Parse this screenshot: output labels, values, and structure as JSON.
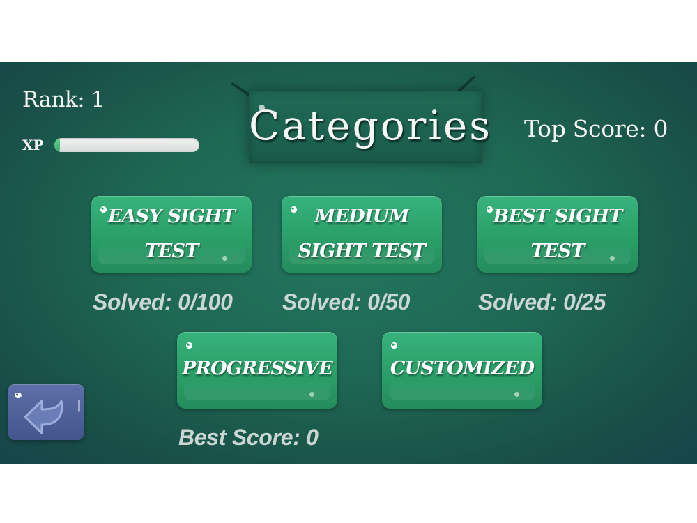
{
  "header": {
    "rank_label": "Rank: 1",
    "xp_label": "XP",
    "xp_progress": 0.04,
    "top_score_label": "Top Score: 0",
    "title": "Categories"
  },
  "categories": [
    {
      "line1": "EASY SIGHT",
      "line2": "TEST",
      "solved": "Solved: 0/100"
    },
    {
      "line1": "MEDIUM",
      "line2": "SIGHT TEST",
      "solved": "Solved: 0/50"
    },
    {
      "line1": "BEST SIGHT",
      "line2": "TEST",
      "solved": "Solved: 0/25"
    }
  ],
  "modes": {
    "progressive_label": "PROGRESSIVE",
    "progressive_best": "Best Score: 0",
    "customized_label": "CUSTOMIZED"
  },
  "icons": {
    "back": "back-arrow-icon"
  },
  "colors": {
    "background": "#1e6754",
    "button_green": "#2a9f68",
    "back_button": "#4f5f99",
    "xp_fill": "#3aae6e",
    "stat_text": "#c9d6d2"
  }
}
